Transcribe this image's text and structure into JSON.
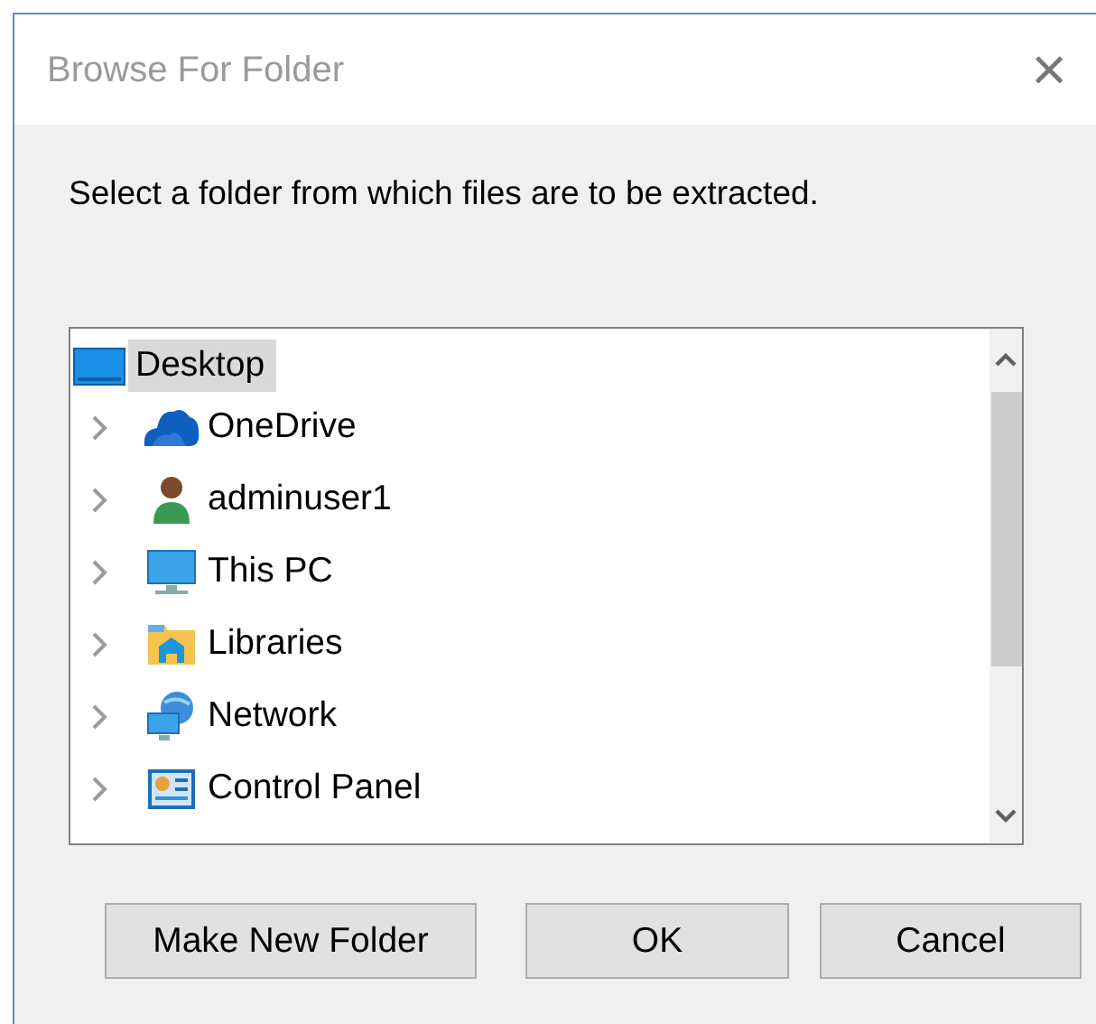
{
  "window": {
    "title": "Browse For Folder",
    "close": "×"
  },
  "instruction": "Select a folder from which files are to be extracted.",
  "tree": [
    {
      "label": "Desktop",
      "selected": true,
      "children": [
        {
          "label": "OneDrive",
          "selected": false,
          "expanded": false
        },
        {
          "label": "adminuser1",
          "selected": false,
          "expanded": false
        },
        {
          "label": "This PC",
          "selected": false,
          "expanded": false
        },
        {
          "label": "Libraries",
          "selected": false,
          "expanded": false
        },
        {
          "label": "Network",
          "selected": false,
          "expanded": false
        },
        {
          "label": "Control Panel",
          "selected": false,
          "expanded": false
        }
      ]
    }
  ],
  "buttons": [
    "Make New Folder",
    "OK",
    "Cancel"
  ]
}
